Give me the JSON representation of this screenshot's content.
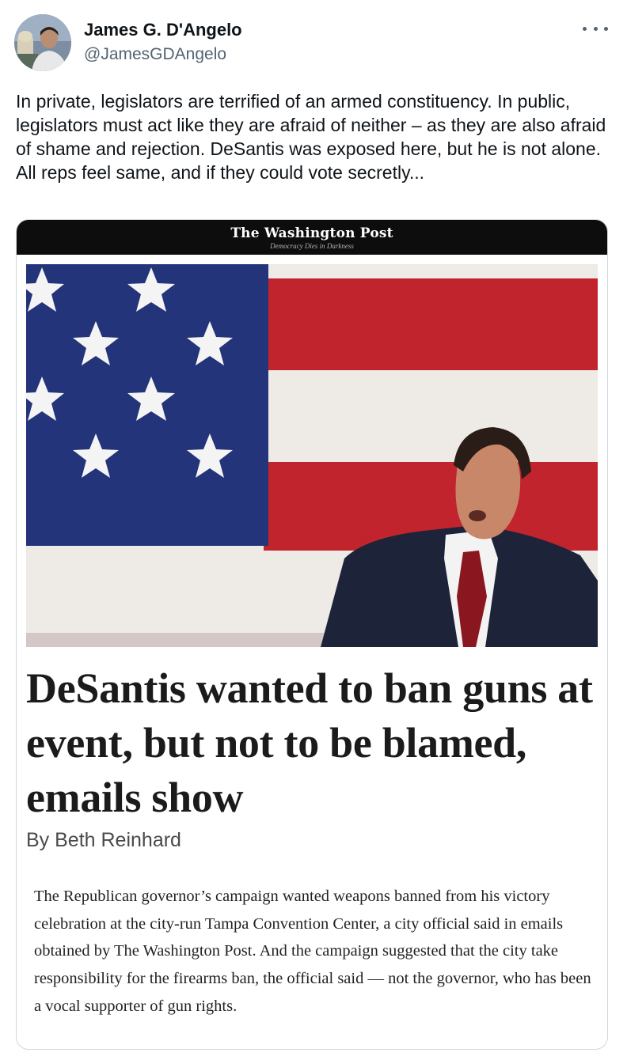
{
  "author": {
    "name": "James G. D'Angelo",
    "handle": "@JamesGDAngelo",
    "avatar_icon": "profile-photo",
    "more_icon": "more-options-icon"
  },
  "tweet": {
    "text": "In private, legislators are terrified of an armed constituency. In public, legislators must act like they are afraid of neither – as they are also afraid of shame and rejection. DeSantis was exposed here, but he is not alone. All reps feel same, and if they could vote secretly..."
  },
  "article": {
    "publication": "The Washington Post",
    "motto": "Democracy Dies in Darkness",
    "headline": "DeSantis wanted to ban guns at event, but not to be blamed, emails show",
    "byline": "By Beth Reinhard",
    "summary": "The Republican governor’s campaign wanted weapons banned from his victory celebration at the city-run Tampa Convention Center, a city official said in emails obtained by The Washington Post. And the campaign suggested that the city take responsibility for the firearms ban, the official said — not the governor, who has been a vocal supporter of gun rights."
  },
  "colors": {
    "flag_blue": "#24347a",
    "flag_red": "#c2242e",
    "flag_white": "#eeeae6",
    "masthead_bg": "#0d0d0d",
    "handle_gray": "#536471"
  }
}
